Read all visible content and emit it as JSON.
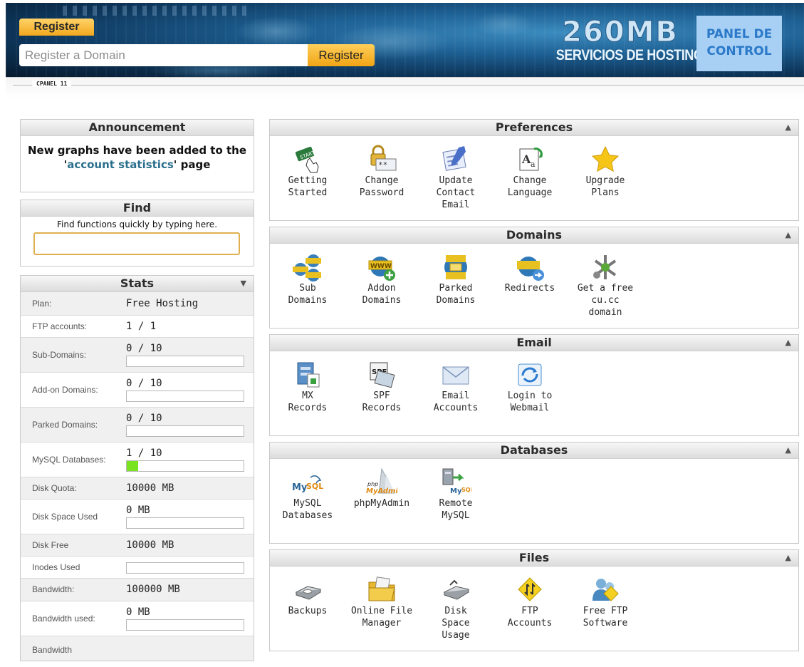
{
  "header": {
    "register_tab": "Register",
    "domain_placeholder": "Register a Domain",
    "register_button": "Register",
    "logo_main": "260MB",
    "logo_sub": "SERVICIOS DE HOSTING",
    "panel_line1": "PANEL DE",
    "panel_line2": "CONTROL"
  },
  "strip_label": "CPANEL 11",
  "announcement": {
    "title": "Announcement",
    "text_before": "New graphs have been added to the '",
    "link": "account statistics",
    "text_after": "' page"
  },
  "find": {
    "title": "Find",
    "hint": "Find functions quickly by typing here.",
    "value": ""
  },
  "stats": {
    "title": "Stats",
    "rows": [
      {
        "label": "Plan:",
        "value": "Free Hosting"
      },
      {
        "label": "FTP accounts:",
        "value": "1 / 1"
      },
      {
        "label": "Sub-Domains:",
        "value": "0 / 10",
        "usage": 0
      },
      {
        "label": "Add-on Domains:",
        "value": "0 / 10",
        "usage": 0
      },
      {
        "label": "Parked Domains:",
        "value": "0 / 10",
        "usage": 0
      },
      {
        "label": "MySQL Databases:",
        "value": "1 / 10",
        "usage": 0.1
      },
      {
        "label": "Disk Quota:",
        "value": "10000 MB"
      },
      {
        "label": "Disk Space Used",
        "value": "0 MB",
        "usage": 0
      },
      {
        "label": "Disk Free",
        "value": "10000 MB"
      },
      {
        "label": "Inodes Used",
        "value": "",
        "usage": 0
      },
      {
        "label": "Bandwidth:",
        "value": "100000 MB"
      },
      {
        "label": "Bandwidth used:",
        "value": "0 MB",
        "usage": 0
      },
      {
        "label": "Bandwidth",
        "value": ""
      }
    ]
  },
  "sections": {
    "preferences": {
      "title": "Preferences",
      "items": [
        {
          "label": "Getting\nStarted",
          "icon": "getting-started-icon"
        },
        {
          "label": "Change\nPassword",
          "icon": "lock-icon"
        },
        {
          "label": "Update\nContact\nEmail",
          "icon": "contact-card-icon"
        },
        {
          "label": "Change\nLanguage",
          "icon": "language-icon"
        },
        {
          "label": "Upgrade\nPlans",
          "icon": "star-icon"
        }
      ]
    },
    "domains": {
      "title": "Domains",
      "items": [
        {
          "label": "Sub\nDomains",
          "icon": "subdomains-icon"
        },
        {
          "label": "Addon\nDomains",
          "icon": "addon-domain-icon"
        },
        {
          "label": "Parked\nDomains",
          "icon": "parked-domain-icon"
        },
        {
          "label": "Redirects",
          "icon": "redirect-icon"
        },
        {
          "label": "Get a free\ncu.cc\ndomain",
          "icon": "free-domain-icon"
        }
      ]
    },
    "email": {
      "title": "Email",
      "items": [
        {
          "label": "MX\nRecords",
          "icon": "mx-records-icon"
        },
        {
          "label": "SPF\nRecords",
          "icon": "spf-records-icon"
        },
        {
          "label": "Email\nAccounts",
          "icon": "envelope-icon"
        },
        {
          "label": "Login to\nWebmail",
          "icon": "webmail-icon"
        }
      ]
    },
    "databases": {
      "title": "Databases",
      "items": [
        {
          "label": "MySQL\nDatabases",
          "icon": "mysql-icon"
        },
        {
          "label": "phpMyAdmin",
          "icon": "phpmyadmin-icon"
        },
        {
          "label": "Remote\nMySQL",
          "icon": "remote-mysql-icon"
        }
      ]
    },
    "files": {
      "title": "Files",
      "items": [
        {
          "label": "Backups",
          "icon": "backup-drive-icon"
        },
        {
          "label": "Online File\nManager",
          "icon": "folder-icon"
        },
        {
          "label": "Disk\nSpace\nUsage",
          "icon": "disk-usage-icon"
        },
        {
          "label": "FTP\nAccounts",
          "icon": "ftp-icon"
        },
        {
          "label": "Free FTP\nSoftware",
          "icon": "ftp-software-icon"
        }
      ]
    }
  }
}
